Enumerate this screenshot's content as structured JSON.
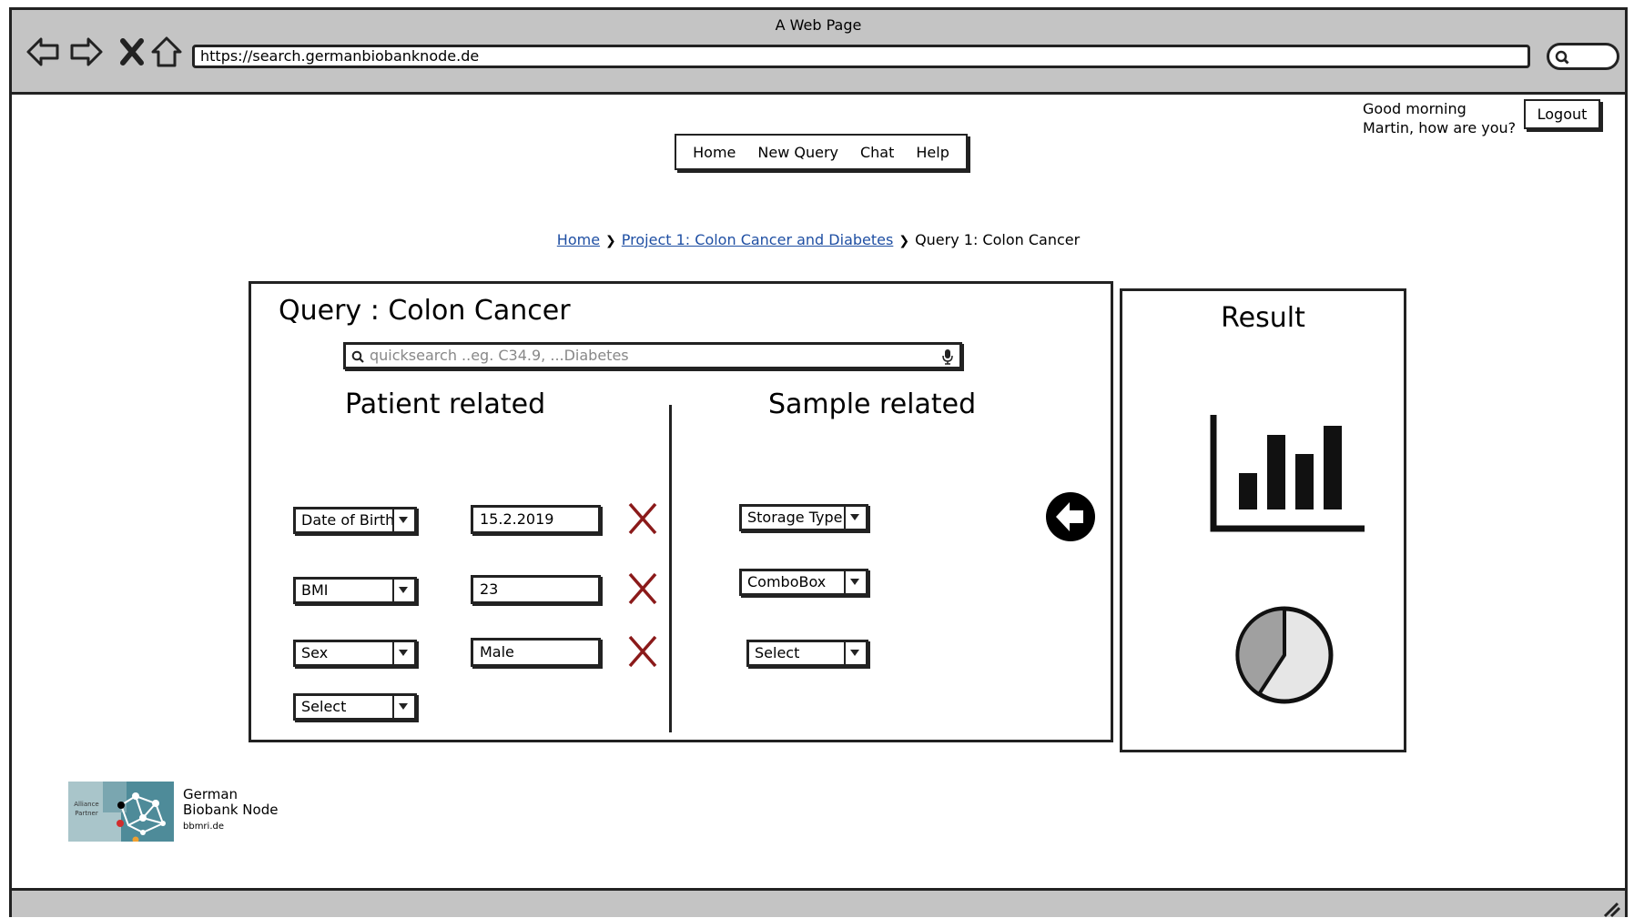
{
  "browser": {
    "window_title": "A Web Page",
    "url": "https://search.germanbiobanknode.de"
  },
  "header": {
    "greeting_line1": "Good morning",
    "greeting_line2": "Martin, how are you?",
    "logout_label": "Logout",
    "nav": [
      "Home",
      "New Query",
      "Chat",
      "Help"
    ]
  },
  "breadcrumb": {
    "items": [
      "Home",
      "Project 1: Colon Cancer and Diabetes",
      "Query 1: Colon Cancer"
    ]
  },
  "query": {
    "title": "Query : Colon Cancer",
    "search_placeholder": "quicksearch ..eg. C34.9, ...Diabetes",
    "patient_heading": "Patient related",
    "sample_heading": "Sample related",
    "patient_rows": [
      {
        "attribute": "Date of Birth",
        "value": "15.2.2019"
      },
      {
        "attribute": "BMI",
        "value": "23"
      },
      {
        "attribute": "Sex",
        "value": "Male"
      },
      {
        "attribute": "Select",
        "value": ""
      }
    ],
    "sample_rows": [
      {
        "attribute": "Storage Type"
      },
      {
        "attribute": "ComboBox"
      },
      {
        "attribute": "Select"
      }
    ],
    "icons": {
      "remove": "close-x-icon",
      "back": "arrow-left-circle-icon",
      "search": "search-icon",
      "mic": "microphone-icon"
    },
    "colors": {
      "remove": "#8b1a1a"
    }
  },
  "result": {
    "title": "Result",
    "icons": [
      "bar-chart-icon",
      "pie-chart-icon"
    ]
  },
  "footer": {
    "logo_badge": "Alliance Partner",
    "logo_name_line1": "German",
    "logo_name_line2": "Biobank Node",
    "logo_url": "bbmri.de"
  }
}
